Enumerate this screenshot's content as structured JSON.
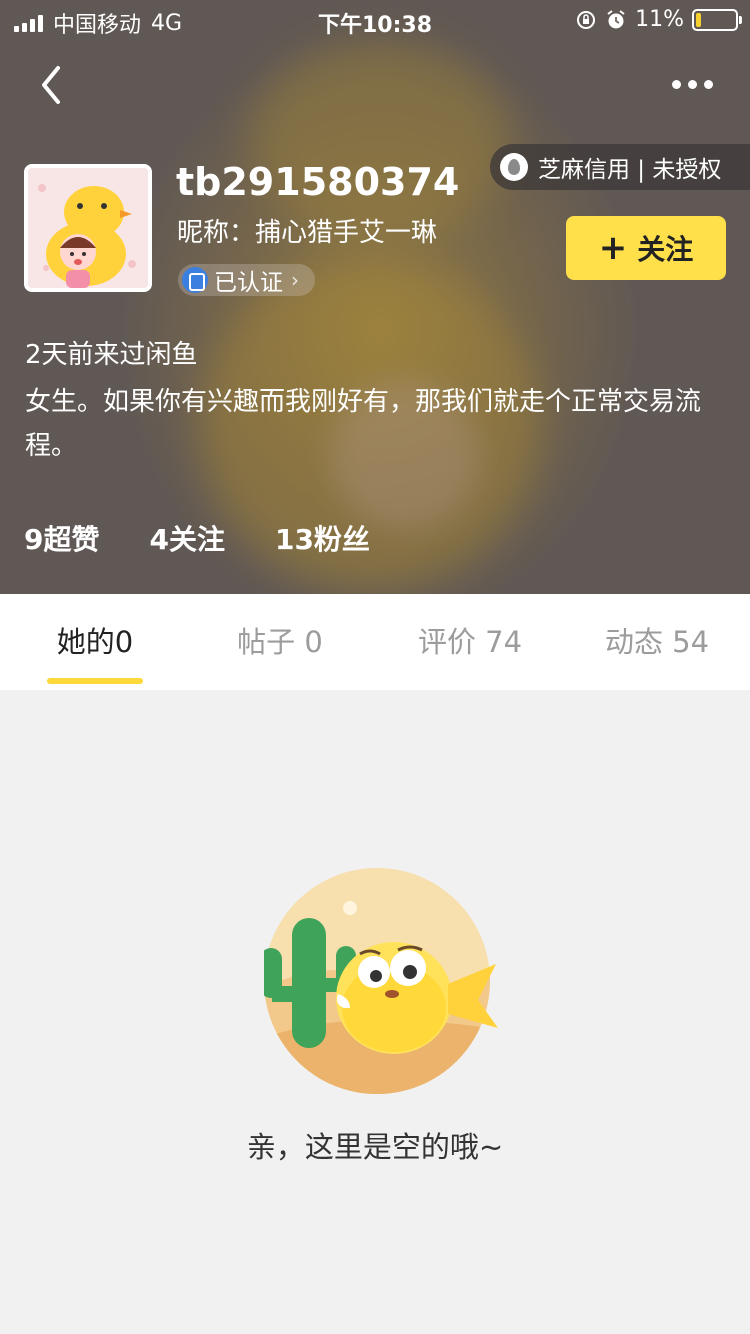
{
  "status_bar": {
    "carrier": "中国移动",
    "network": "4G",
    "time": "下午10:38",
    "battery": "11%",
    "battery_level": 0.11
  },
  "nav": {
    "back_icon": "chevron-left-icon",
    "more_icon": "more-dots-icon"
  },
  "credit": {
    "label": "芝麻信用 | 未授权",
    "icon": "sesame-credit-icon"
  },
  "profile": {
    "username": "tb291580374",
    "nickname": "昵称：捕心猎手艾一琳",
    "verified_label": "已认证",
    "follow_label": "关注",
    "last_seen": "2天前来过闲鱼",
    "bio": "女生。如果你有兴趣而我刚好有，那我们就走个正常交易流程。"
  },
  "stats": {
    "likes": "9超赞",
    "following": "4关注",
    "followers": "13粉丝"
  },
  "tabs": [
    {
      "label": "她的0",
      "active": true
    },
    {
      "label": "帖子 0",
      "active": false
    },
    {
      "label": "评价 74",
      "active": false
    },
    {
      "label": "动态 54",
      "active": false
    }
  ],
  "empty_state": {
    "message": "亲，这里是空的哦~"
  },
  "colors": {
    "accent": "#ffe04b",
    "tab_indicator": "#ffd83a",
    "verified_blue": "#3b7fe0"
  }
}
